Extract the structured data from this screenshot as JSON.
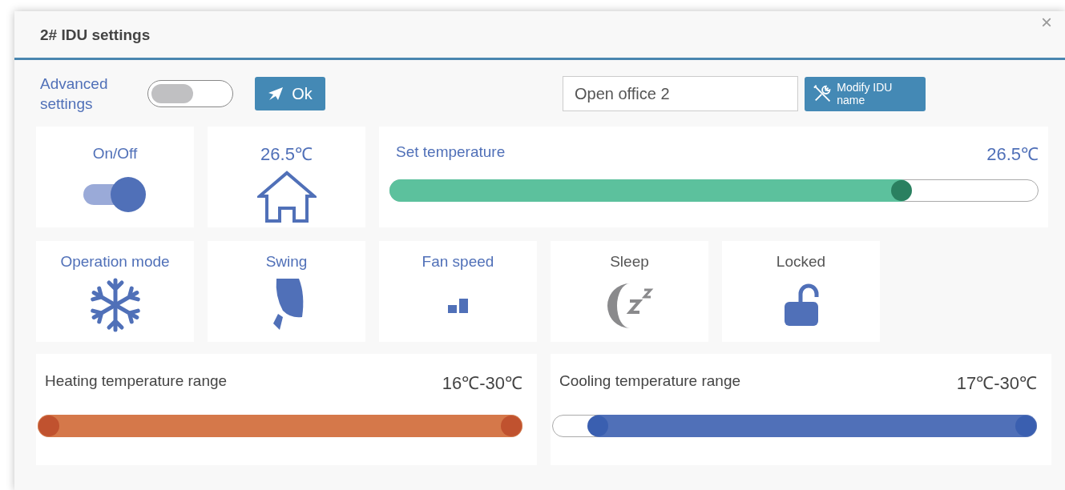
{
  "dialog": {
    "title": "2# IDU settings",
    "close": "×"
  },
  "advanced": {
    "label": "Advanced settings",
    "on": false
  },
  "ok_button": {
    "label": "Ok"
  },
  "idu_name": {
    "value": "Open office 2"
  },
  "modify_button": {
    "label": "Modify IDU name"
  },
  "power": {
    "label": "On/Off",
    "on": true
  },
  "room_temperature": {
    "value": "26.5℃"
  },
  "set_temperature": {
    "label": "Set temperature",
    "reading": "26.5℃",
    "level": 0.79
  },
  "tiles": [
    {
      "kind": "mode",
      "label": "Operation mode",
      "active": true
    },
    {
      "kind": "swing",
      "label": "Swing",
      "active": true
    },
    {
      "kind": "fan",
      "label": "Fan speed",
      "active": true
    },
    {
      "kind": "sleep",
      "label": "Sleep",
      "active": false
    },
    {
      "kind": "lock",
      "label": "Locked",
      "active": false
    }
  ],
  "ranges": [
    {
      "kind": "heating",
      "label": "Heating temperature range",
      "reading": "16℃-30℃",
      "thumbs": [
        {
          "level": 0
        },
        {
          "level": 1
        }
      ]
    },
    {
      "kind": "cooling",
      "label": "Cooling temperature range",
      "reading": "17℃-30℃",
      "thumbs": [
        {
          "level": 0.075
        },
        {
          "level": 1
        }
      ]
    }
  ]
}
